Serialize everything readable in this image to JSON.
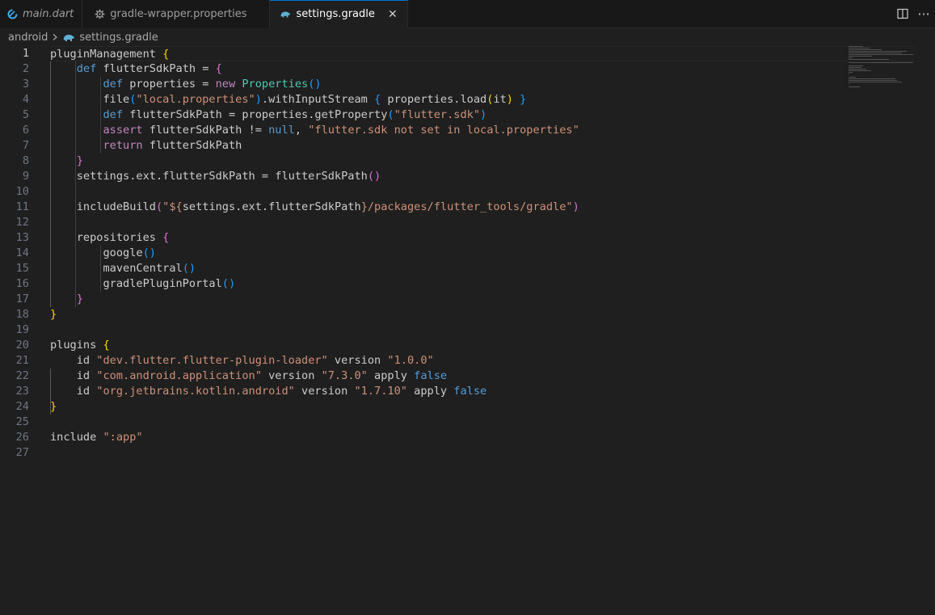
{
  "tabs": [
    {
      "label": "main.dart",
      "icon": "dart-icon",
      "italic": true,
      "active": false
    },
    {
      "label": "gradle-wrapper.properties",
      "icon": "gear-icon",
      "italic": false,
      "active": false
    },
    {
      "label": "settings.gradle",
      "icon": "gradle-elephant-icon",
      "italic": false,
      "active": true
    }
  ],
  "tab_close_glyph": "✕",
  "actions": [
    {
      "name": "split-editor-icon"
    },
    {
      "name": "more-actions-icon",
      "glyph": "···"
    }
  ],
  "breadcrumb": {
    "folder": "android",
    "file": "settings.gradle"
  },
  "editor": {
    "current_line": 1,
    "line_numbers": [
      "1",
      "2",
      "3",
      "4",
      "5",
      "6",
      "7",
      "8",
      "9",
      "10",
      "11",
      "12",
      "13",
      "14",
      "15",
      "16",
      "17",
      "18",
      "19",
      "20",
      "21",
      "22",
      "23",
      "24",
      "25",
      "26",
      "27"
    ],
    "lines": [
      [
        {
          "t": "pluginManagement "
        },
        {
          "t": "{",
          "c": "b1"
        }
      ],
      [
        {
          "t": "    "
        },
        {
          "t": "def",
          "c": "kw"
        },
        {
          "t": " flutterSdkPath = "
        },
        {
          "t": "{",
          "c": "b2"
        }
      ],
      [
        {
          "t": "        "
        },
        {
          "t": "def",
          "c": "kw"
        },
        {
          "t": " properties = "
        },
        {
          "t": "new",
          "c": "kw2"
        },
        {
          "t": " "
        },
        {
          "t": "Properties",
          "c": "cls"
        },
        {
          "t": "()",
          "c": "b3"
        }
      ],
      [
        {
          "t": "        file"
        },
        {
          "t": "(",
          "c": "b3"
        },
        {
          "t": "\"local.properties\"",
          "c": "str"
        },
        {
          "t": ")",
          "c": "b3"
        },
        {
          "t": ".withInputStream "
        },
        {
          "t": "{",
          "c": "b3"
        },
        {
          "t": " properties.load"
        },
        {
          "t": "(",
          "c": "b1"
        },
        {
          "t": "it"
        },
        {
          "t": ")",
          "c": "b1"
        },
        {
          "t": " "
        },
        {
          "t": "}",
          "c": "b3"
        }
      ],
      [
        {
          "t": "        "
        },
        {
          "t": "def",
          "c": "kw"
        },
        {
          "t": " flutterSdkPath = properties.getProperty"
        },
        {
          "t": "(",
          "c": "b3"
        },
        {
          "t": "\"flutter.sdk\"",
          "c": "str"
        },
        {
          "t": ")",
          "c": "b3"
        }
      ],
      [
        {
          "t": "        "
        },
        {
          "t": "assert",
          "c": "kw2"
        },
        {
          "t": " flutterSdkPath != "
        },
        {
          "t": "null",
          "c": "kw"
        },
        {
          "t": ", "
        },
        {
          "t": "\"flutter.sdk not set in local.properties\"",
          "c": "str"
        }
      ],
      [
        {
          "t": "        "
        },
        {
          "t": "return",
          "c": "kw2"
        },
        {
          "t": " flutterSdkPath"
        }
      ],
      [
        {
          "t": "    "
        },
        {
          "t": "}",
          "c": "b2"
        }
      ],
      [
        {
          "t": "    settings.ext.flutterSdkPath = flutterSdkPath"
        },
        {
          "t": "()",
          "c": "b2"
        }
      ],
      [
        {
          "t": ""
        }
      ],
      [
        {
          "t": "    includeBuild"
        },
        {
          "t": "(",
          "c": "b2"
        },
        {
          "t": "\"${",
          "c": "str"
        },
        {
          "t": "settings.ext.flutterSdkPath"
        },
        {
          "t": "}/packages/flutter_tools/gradle\"",
          "c": "str"
        },
        {
          "t": ")",
          "c": "b2"
        }
      ],
      [
        {
          "t": ""
        }
      ],
      [
        {
          "t": "    repositories "
        },
        {
          "t": "{",
          "c": "b2"
        }
      ],
      [
        {
          "t": "        google"
        },
        {
          "t": "()",
          "c": "b3"
        }
      ],
      [
        {
          "t": "        mavenCentral"
        },
        {
          "t": "()",
          "c": "b3"
        }
      ],
      [
        {
          "t": "        gradlePluginPortal"
        },
        {
          "t": "()",
          "c": "b3"
        }
      ],
      [
        {
          "t": "    "
        },
        {
          "t": "}",
          "c": "b2"
        }
      ],
      [
        {
          "t": "}",
          "c": "b1"
        }
      ],
      [
        {
          "t": ""
        }
      ],
      [
        {
          "t": "plugins "
        },
        {
          "t": "{",
          "c": "b1"
        }
      ],
      [
        {
          "t": "    id "
        },
        {
          "t": "\"dev.flutter.flutter-plugin-loader\"",
          "c": "str"
        },
        {
          "t": " version "
        },
        {
          "t": "\"1.0.0\"",
          "c": "str"
        }
      ],
      [
        {
          "t": "    id "
        },
        {
          "t": "\"com.android.application\"",
          "c": "str"
        },
        {
          "t": " version "
        },
        {
          "t": "\"7.3.0\"",
          "c": "str"
        },
        {
          "t": " apply "
        },
        {
          "t": "false",
          "c": "kw"
        }
      ],
      [
        {
          "t": "    id "
        },
        {
          "t": "\"org.jetbrains.kotlin.android\"",
          "c": "str"
        },
        {
          "t": " version "
        },
        {
          "t": "\"1.7.10\"",
          "c": "str"
        },
        {
          "t": " apply "
        },
        {
          "t": "false",
          "c": "kw"
        }
      ],
      [
        {
          "t": "}",
          "c": "b1"
        }
      ],
      [
        {
          "t": ""
        }
      ],
      [
        {
          "t": "include "
        },
        {
          "t": "\":app\"",
          "c": "str"
        }
      ],
      [
        {
          "t": ""
        }
      ]
    ]
  },
  "colors": {
    "accent": "#0078d4",
    "background": "#1f1f1f",
    "tabbar": "#181818"
  }
}
